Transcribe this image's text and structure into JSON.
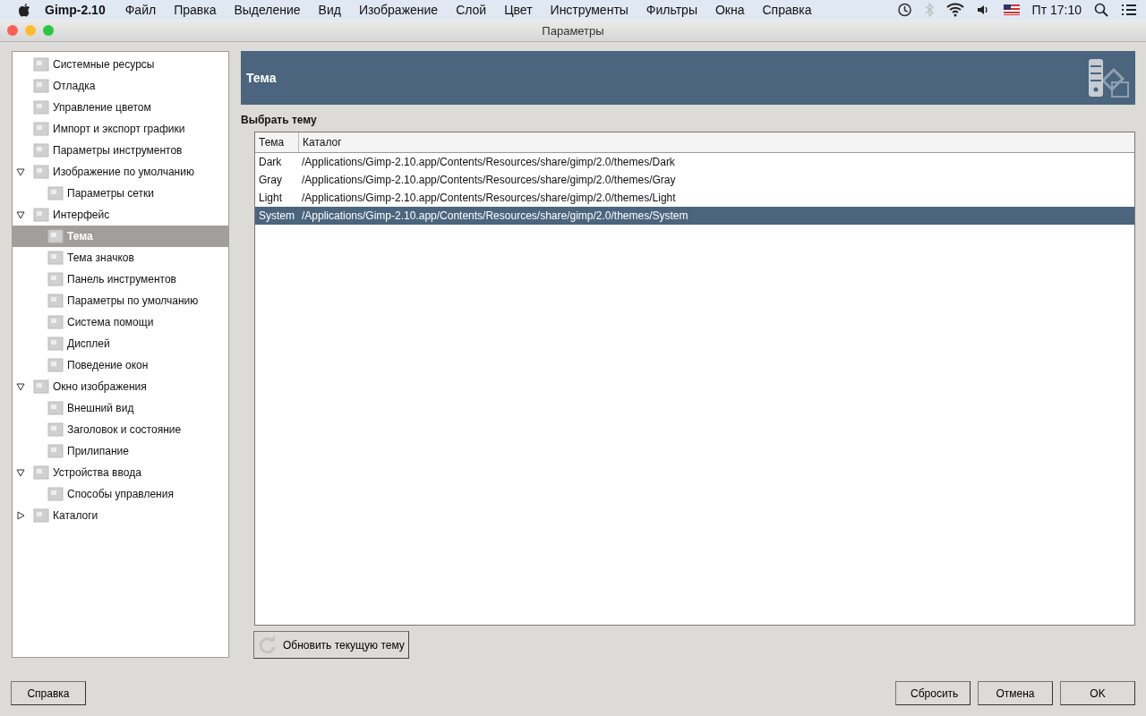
{
  "menubar": {
    "app": "Gimp-2.10",
    "items": [
      "Файл",
      "Правка",
      "Выделение",
      "Вид",
      "Изображение",
      "Слой",
      "Цвет",
      "Инструменты",
      "Фильтры",
      "Окна",
      "Справка"
    ],
    "clock": "Пт 17:10"
  },
  "window": {
    "title": "Параметры"
  },
  "sidebar": {
    "items": [
      {
        "label": "Системные ресурсы",
        "selected": false
      },
      {
        "label": "Отладка",
        "selected": false
      },
      {
        "label": "Управление цветом",
        "selected": false
      },
      {
        "label": "Импорт и экспорт графики",
        "selected": false
      },
      {
        "label": "Параметры инструментов",
        "selected": false
      },
      {
        "label": "Изображение по умолчанию",
        "selected": false,
        "expanded": true,
        "children": [
          {
            "label": "Параметры сетки",
            "selected": false
          }
        ]
      },
      {
        "label": "Интерфейс",
        "selected": false,
        "expanded": true,
        "children": [
          {
            "label": "Тема",
            "selected": true
          },
          {
            "label": "Тема значков",
            "selected": false
          },
          {
            "label": "Панель инструментов",
            "selected": false
          },
          {
            "label": "Параметры по умолчанию",
            "selected": false
          },
          {
            "label": "Система помощи",
            "selected": false
          },
          {
            "label": "Дисплей",
            "selected": false
          },
          {
            "label": "Поведение окон",
            "selected": false
          }
        ]
      },
      {
        "label": "Окно изображения",
        "selected": false,
        "expanded": true,
        "children": [
          {
            "label": "Внешний вид",
            "selected": false
          },
          {
            "label": "Заголовок и состояние",
            "selected": false
          },
          {
            "label": "Прилипание",
            "selected": false
          }
        ]
      },
      {
        "label": "Устройства ввода",
        "selected": false,
        "expanded": true,
        "children": [
          {
            "label": "Способы управления",
            "selected": false
          }
        ]
      },
      {
        "label": "Каталоги",
        "selected": false,
        "expanded": false
      }
    ]
  },
  "panel": {
    "title": "Тема",
    "section": "Выбрать тему",
    "table": {
      "columns": [
        "Тема",
        "Каталог"
      ],
      "rows": [
        {
          "cells": [
            "Dark",
            "/Applications/Gimp-2.10.app/Contents/Resources/share/gimp/2.0/themes/Dark"
          ],
          "selected": false
        },
        {
          "cells": [
            "Gray",
            "/Applications/Gimp-2.10.app/Contents/Resources/share/gimp/2.0/themes/Gray"
          ],
          "selected": false
        },
        {
          "cells": [
            "Light",
            "/Applications/Gimp-2.10.app/Contents/Resources/share/gimp/2.0/themes/Light"
          ],
          "selected": false
        },
        {
          "cells": [
            "System",
            "/Applications/Gimp-2.10.app/Contents/Resources/share/gimp/2.0/themes/System"
          ],
          "selected": true
        }
      ]
    },
    "refresh_button": "Обновить текущую тему"
  },
  "buttons": {
    "help": "Справка",
    "reset": "Сбросить",
    "cancel": "Отмена",
    "ok": "OK"
  }
}
